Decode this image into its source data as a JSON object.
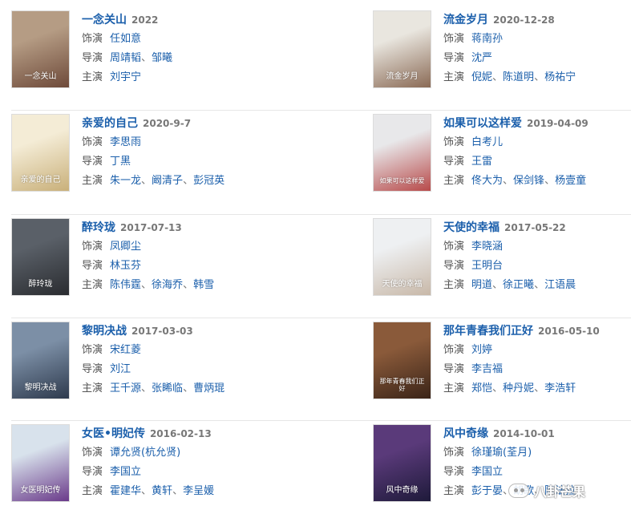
{
  "labels": {
    "role": "饰演",
    "director": "导演",
    "cast": "主演"
  },
  "dramas": [
    {
      "title": "一念关山",
      "date": "2022",
      "role": [
        "任如意"
      ],
      "director": [
        "周靖韬",
        "邹曦"
      ],
      "cast": [
        "刘宇宁"
      ],
      "poster_text": "一念关山",
      "colors": [
        "#b59c84",
        "#6e4a3a"
      ]
    },
    {
      "title": "流金岁月",
      "date": "2020-12-28",
      "role": [
        "蒋南孙"
      ],
      "director": [
        "沈严"
      ],
      "cast": [
        "倪妮",
        "陈道明",
        "杨祐宁"
      ],
      "poster_text": "流金岁月",
      "colors": [
        "#e9e6df",
        "#8a6a55"
      ]
    },
    {
      "title": "亲爱的自己",
      "date": "2020-9-7",
      "role": [
        "李思雨"
      ],
      "director": [
        "丁黑"
      ],
      "cast": [
        "朱一龙",
        "阚清子",
        "彭冠英"
      ],
      "poster_text": "亲爱的自己",
      "colors": [
        "#f4ecd6",
        "#c9b07a"
      ]
    },
    {
      "title": "如果可以这样爱",
      "date": "2019-04-09",
      "role": [
        "白考儿"
      ],
      "director": [
        "王雷"
      ],
      "cast": [
        "佟大为",
        "保剑锋",
        "杨壹童"
      ],
      "poster_text": "如果可以这样爱",
      "colors": [
        "#e8e8ea",
        "#b84a4a"
      ]
    },
    {
      "title": "醉玲珑",
      "date": "2017-07-13",
      "role": [
        "凤卿尘"
      ],
      "director": [
        "林玉芬"
      ],
      "cast": [
        "陈伟霆",
        "徐海乔",
        "韩雪"
      ],
      "poster_text": "醉玲珑",
      "colors": [
        "#5a6068",
        "#2a2c30"
      ]
    },
    {
      "title": "天使的幸福",
      "date": "2017-05-22",
      "role": [
        "李晓涵"
      ],
      "director": [
        "王明台"
      ],
      "cast": [
        "明道",
        "徐正曦",
        "江语晨"
      ],
      "poster_text": "天使的幸福",
      "colors": [
        "#eef0f2",
        "#c8b8a8"
      ]
    },
    {
      "title": "黎明决战",
      "date": "2017-03-03",
      "role": [
        "宋红菱"
      ],
      "director": [
        "刘江"
      ],
      "cast": [
        "王千源",
        "张睎临",
        "曹炳琨"
      ],
      "poster_text": "黎明决战",
      "colors": [
        "#7c8fa6",
        "#2e3a4d"
      ]
    },
    {
      "title": "那年青春我们正好",
      "date": "2016-05-10",
      "role": [
        "刘婷"
      ],
      "director": [
        "李吉福"
      ],
      "cast": [
        "郑恺",
        "种丹妮",
        "李浩轩"
      ],
      "poster_text": "那年青春我们正好",
      "colors": [
        "#8a5a3a",
        "#3a2418"
      ]
    },
    {
      "title": "女医•明妃传",
      "date": "2016-02-13",
      "role": [
        "谭允贤(杭允贤)"
      ],
      "director": [
        "李国立"
      ],
      "cast": [
        "霍建华",
        "黄轩",
        "李呈媛"
      ],
      "poster_text": "女医明妃传",
      "colors": [
        "#d8e2ec",
        "#6a3a8a"
      ]
    },
    {
      "title": "风中奇缘",
      "date": "2014-10-01",
      "role": [
        "徐瑾瑜(荃月)"
      ],
      "director": [
        "李国立"
      ],
      "cast": [
        "彭于晏",
        "胡歌",
        "陈法拉"
      ],
      "poster_text": "风中奇缘",
      "colors": [
        "#5a3a7a",
        "#1e1a3a"
      ]
    }
  ],
  "watermark": {
    "text": "八卦芒果",
    "icon": "wechat-icon"
  }
}
